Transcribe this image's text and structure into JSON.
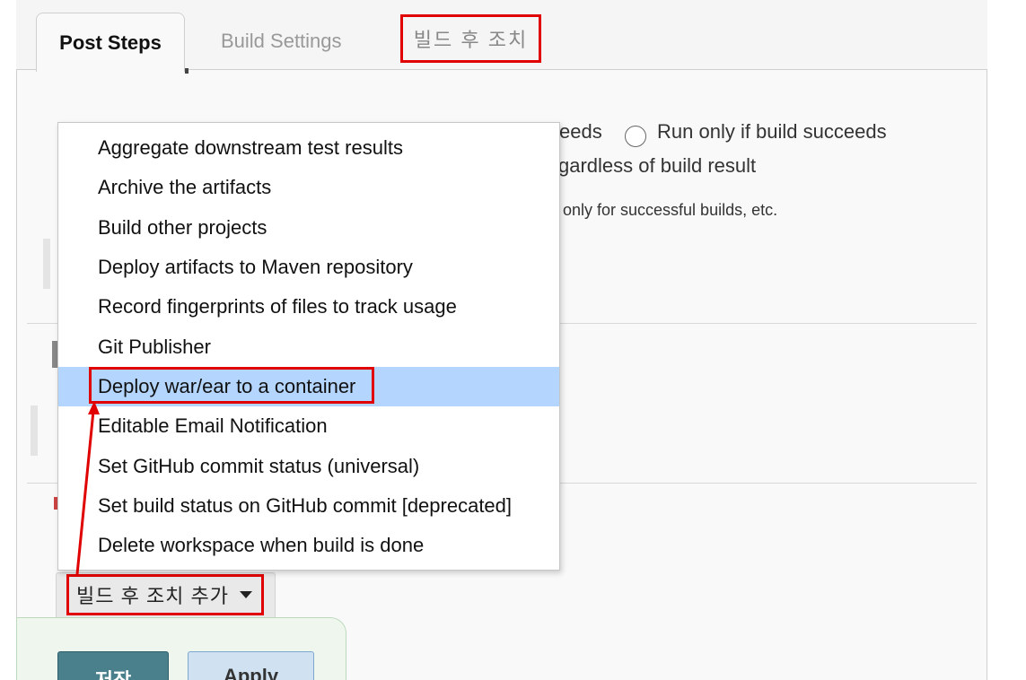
{
  "tabs": [
    {
      "label": "Post Steps"
    },
    {
      "label": "Build Settings"
    },
    {
      "label": "빌드 후 조치"
    }
  ],
  "background": {
    "radio_partial_left": "ceeds",
    "radio_option": "Run only if build succeeds",
    "radio_option_2_partial": "gardless of build result",
    "help_partial": "only for successful builds, etc."
  },
  "menu": {
    "items": [
      {
        "label": "Aggregate downstream test results"
      },
      {
        "label": "Archive the artifacts"
      },
      {
        "label": "Build other projects"
      },
      {
        "label": "Deploy artifacts to Maven repository"
      },
      {
        "label": "Record fingerprints of files to track usage"
      },
      {
        "label": "Git Publisher"
      },
      {
        "label": "Deploy war/ear to a container"
      },
      {
        "label": "Editable Email Notification"
      },
      {
        "label": "Set GitHub commit status (universal)"
      },
      {
        "label": "Set build status on GitHub commit [deprecated]"
      },
      {
        "label": "Delete workspace when build is done"
      }
    ],
    "selected_label": "Deploy war/ear to a container"
  },
  "add_post_build_button": {
    "label": "빌드 후 조치 추가"
  },
  "footer": {
    "save_label": "저장",
    "apply_label": "Apply"
  },
  "colors": {
    "annotation": "#e00000",
    "selection": "#b4d5fe",
    "save_button": "#4a7f8c",
    "apply_button": "#d0e2f2"
  },
  "icons": [
    "chevron-down-icon",
    "radio-icon",
    "annotation-arrow-icon"
  ]
}
